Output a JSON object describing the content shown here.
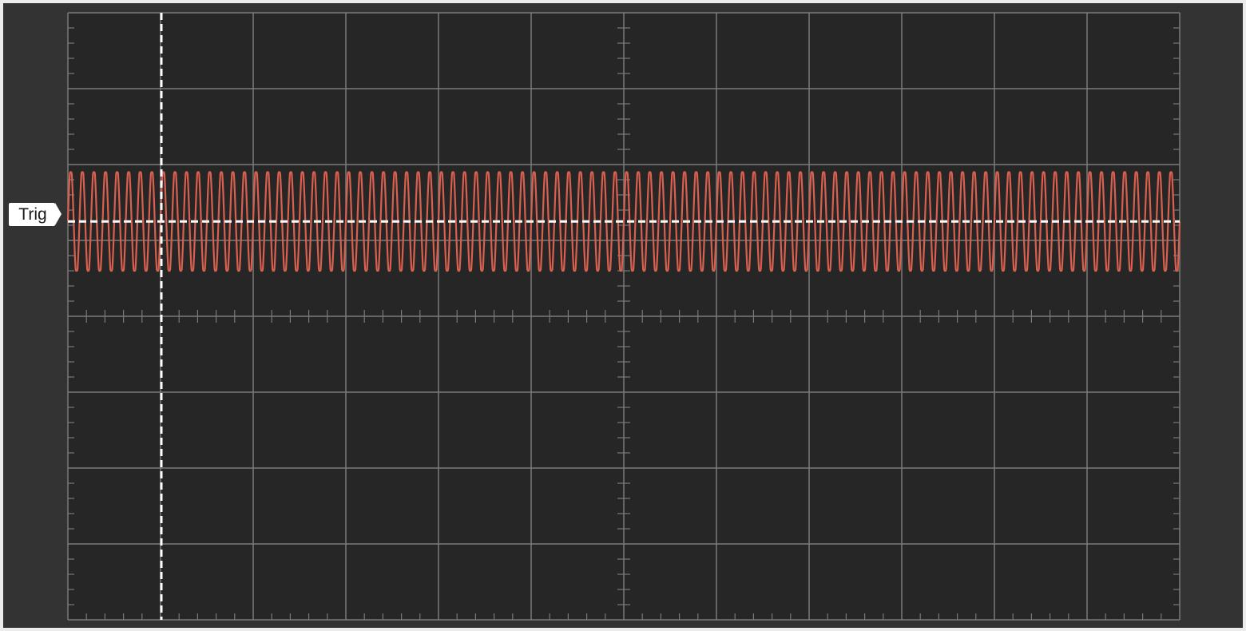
{
  "scope": {
    "trigger_label": "Trig",
    "divisions": {
      "horizontal": 12,
      "vertical": 8
    },
    "minor_ticks_per_division": 5,
    "colors": {
      "background": "#333333",
      "graticule_bg": "#262626",
      "grid": "#7a7a7a",
      "trace": "#d9604f",
      "trigger_line": "#ffffff",
      "label_bg": "#ffffff"
    },
    "trigger": {
      "level_div": 2.75,
      "position_div": 1.0
    }
  },
  "chart_data": {
    "type": "line",
    "title": "",
    "xlabel": "",
    "ylabel": "",
    "series": [
      {
        "name": "",
        "color": "#d9604f",
        "waveform": "periodic",
        "cycles_on_screen": 96,
        "max_div": 2.1,
        "min_div": 3.4,
        "mean_div": 2.75
      }
    ]
  }
}
